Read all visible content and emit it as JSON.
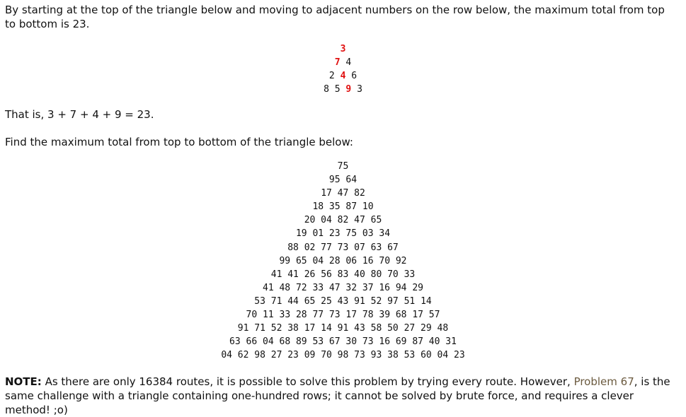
{
  "intro_text": "By starting at the top of the triangle below and moving to adjacent numbers on the row below, the maximum total from top to bottom is 23.",
  "small_triangle": [
    [
      {
        "v": "3",
        "red": true
      }
    ],
    [
      {
        "v": "7",
        "red": true
      },
      {
        "v": "4",
        "red": false
      }
    ],
    [
      {
        "v": "2",
        "red": false
      },
      {
        "v": "4",
        "red": true
      },
      {
        "v": "6",
        "red": false
      }
    ],
    [
      {
        "v": "8",
        "red": false
      },
      {
        "v": "5",
        "red": false
      },
      {
        "v": "9",
        "red": true
      },
      {
        "v": "3",
        "red": false
      }
    ]
  ],
  "that_is_text": "That is, 3 + 7 + 4 + 9 = 23.",
  "find_text": "Find the maximum total from top to bottom of the triangle below:",
  "big_triangle": [
    "75",
    "95 64",
    "17 47 82",
    "18 35 87 10",
    "20 04 82 47 65",
    "19 01 23 75 03 34",
    "88 02 77 73 07 63 67",
    "99 65 04 28 06 16 70 92",
    "41 41 26 56 83 40 80 70 33",
    "41 48 72 33 47 32 37 16 94 29",
    "53 71 44 65 25 43 91 52 97 51 14",
    "70 11 33 28 77 73 17 78 39 68 17 57",
    "91 71 52 38 17 14 91 43 58 50 27 29 48",
    "63 66 04 68 89 53 67 30 73 16 69 87 40 31",
    "04 62 98 27 23 09 70 98 73 93 38 53 60 04 23"
  ],
  "note": {
    "label": "NOTE:",
    "text_before": " As there are only 16384 routes, it is possible to solve this problem by trying every route. However, ",
    "link": "Problem 67",
    "text_after": ", is the same challenge with a triangle containing one-hundred rows; it cannot be solved by brute force, and requires a clever method! ;o)"
  },
  "colors": {
    "highlight": "#e01010",
    "link": "#6b5a3f"
  }
}
